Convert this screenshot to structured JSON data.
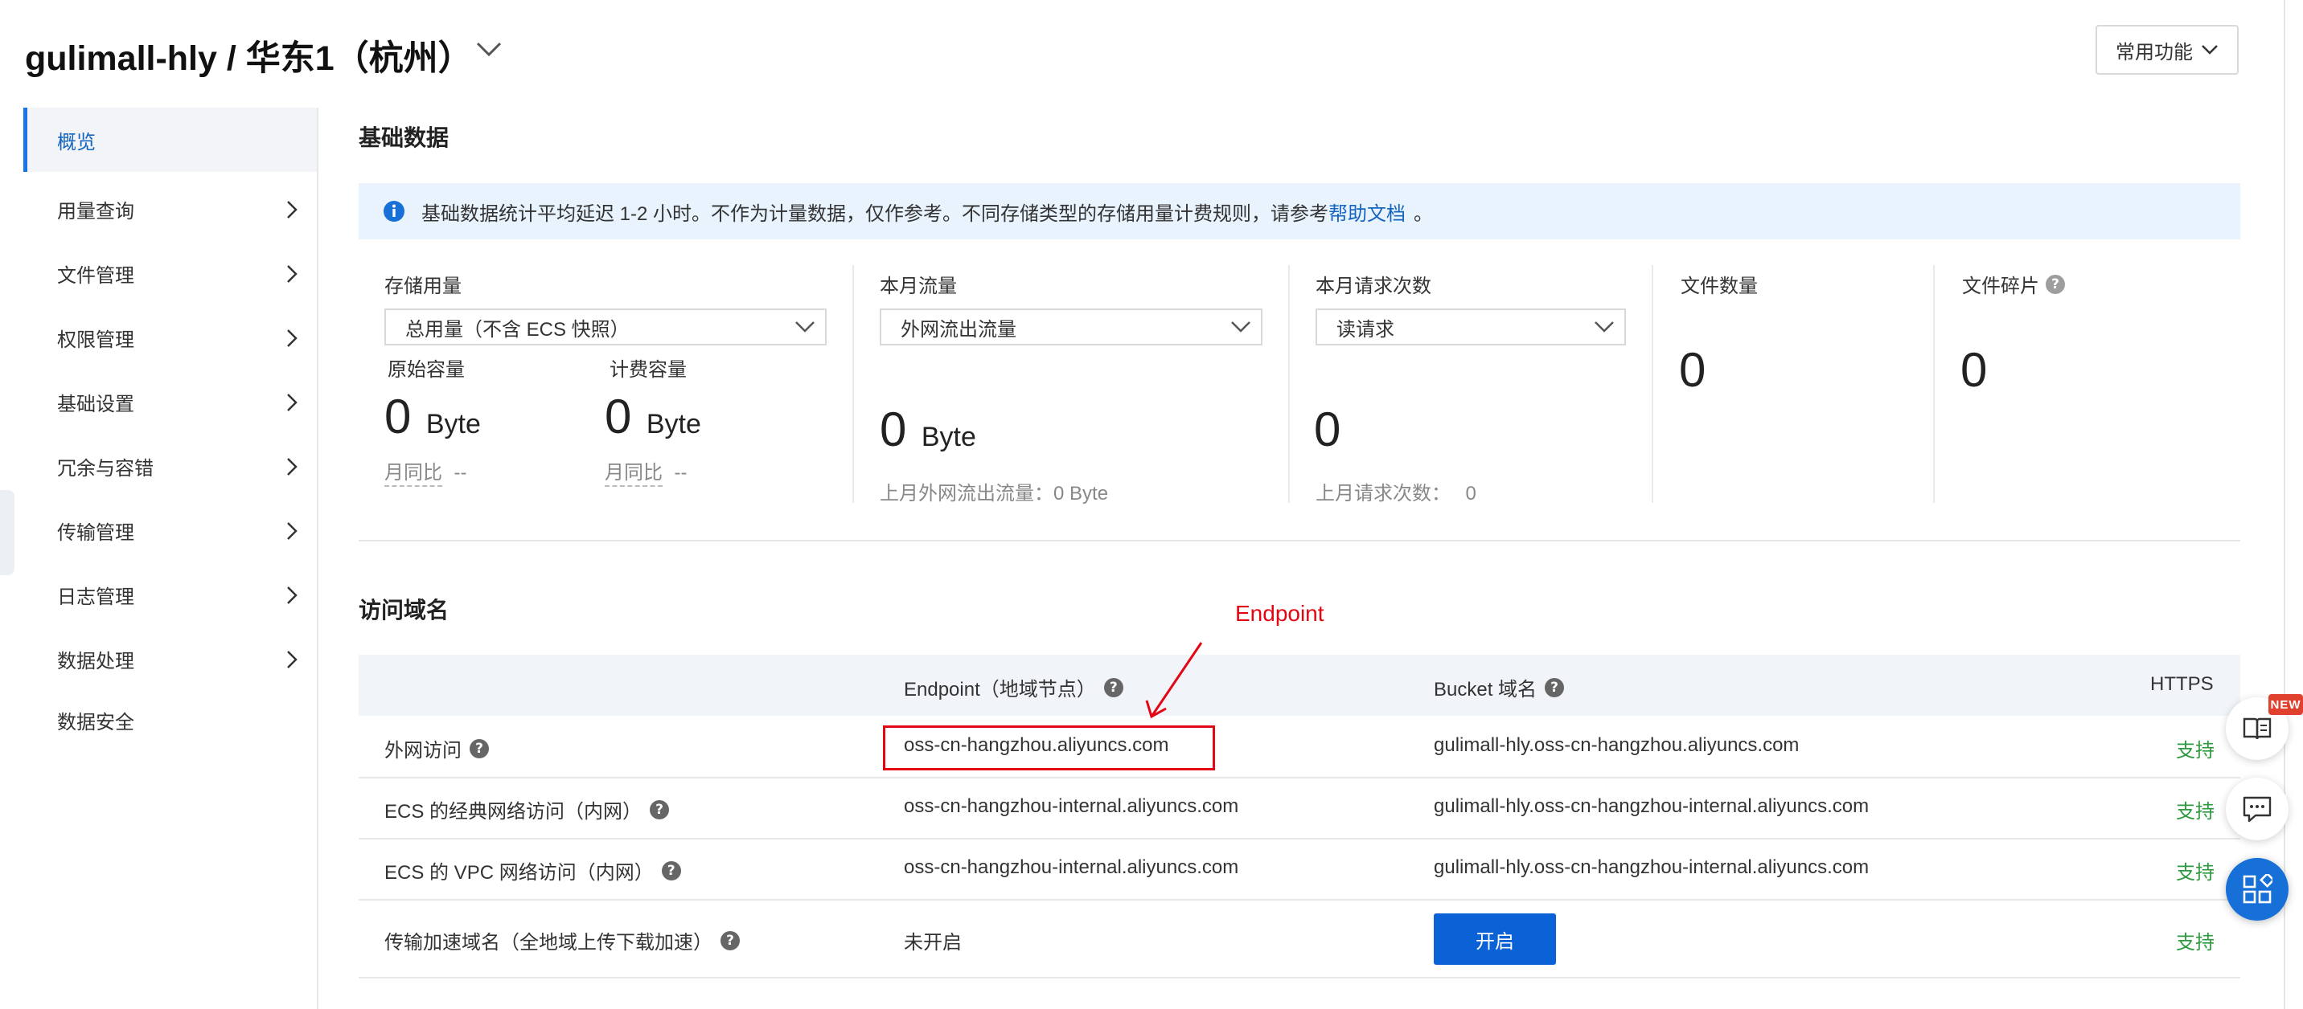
{
  "header": {
    "title": "gulimall-hly / 华东1（杭州）",
    "common_functions": "常用功能"
  },
  "sidebar": {
    "items": [
      {
        "label": "概览"
      },
      {
        "label": "用量查询"
      },
      {
        "label": "文件管理"
      },
      {
        "label": "权限管理"
      },
      {
        "label": "基础设置"
      },
      {
        "label": "冗余与容错"
      },
      {
        "label": "传输管理"
      },
      {
        "label": "日志管理"
      },
      {
        "label": "数据处理"
      },
      {
        "label": "数据安全"
      }
    ]
  },
  "basic_data": {
    "title": "基础数据",
    "notice": "基础数据统计平均延迟 1-2 小时。不作为计量数据，仅作参考。不同存储类型的存储用量计费规则，请参考",
    "notice_link": "帮助文档",
    "notice_tail": "。",
    "storage": {
      "label": "存储用量",
      "select": "总用量（不含 ECS 快照）",
      "raw_label": "原始容量",
      "raw_value": "0",
      "raw_unit": "Byte",
      "billed_label": "计费容量",
      "billed_value": "0",
      "billed_unit": "Byte",
      "mom_label": "月同比",
      "mom_value": "--"
    },
    "traffic": {
      "label": "本月流量",
      "select": "外网流出流量",
      "value": "0",
      "unit": "Byte",
      "last_month": "上月外网流出流量：0 Byte"
    },
    "requests": {
      "label": "本月请求次数",
      "select": "读请求",
      "value": "0",
      "last_month_label": "上月请求次数：",
      "last_month_value": "0"
    },
    "files": {
      "label": "文件数量",
      "value": "0"
    },
    "fragments": {
      "label": "文件碎片",
      "value": "0"
    }
  },
  "domains": {
    "title": "访问域名",
    "columns": [
      "Endpoint（地域节点）",
      "Bucket 域名",
      "HTTPS"
    ],
    "rows": [
      {
        "name": "外网访问",
        "endpoint": "oss-cn-hangzhou.aliyuncs.com",
        "bucket": "gulimall-hly.oss-cn-hangzhou.aliyuncs.com",
        "https": "支持"
      },
      {
        "name": "ECS 的经典网络访问（内网）",
        "endpoint": "oss-cn-hangzhou-internal.aliyuncs.com",
        "bucket": "gulimall-hly.oss-cn-hangzhou-internal.aliyuncs.com",
        "https": "支持"
      },
      {
        "name": "ECS 的 VPC 网络访问（内网）",
        "endpoint": "oss-cn-hangzhou-internal.aliyuncs.com",
        "bucket": "gulimall-hly.oss-cn-hangzhou-internal.aliyuncs.com",
        "https": "支持"
      },
      {
        "name": "传输加速域名（全地域上传下载加速）",
        "endpoint": "未开启",
        "button": "开启",
        "https": "支持"
      }
    ]
  },
  "annotation": {
    "label": "Endpoint",
    "color": "#e30613"
  },
  "badges": {
    "new": "NEW"
  },
  "colors": {
    "accent": "#1565c0",
    "primary_button": "#0b62d6",
    "success": "#2e9a3f",
    "notice_bg": "#e8f3fd"
  }
}
